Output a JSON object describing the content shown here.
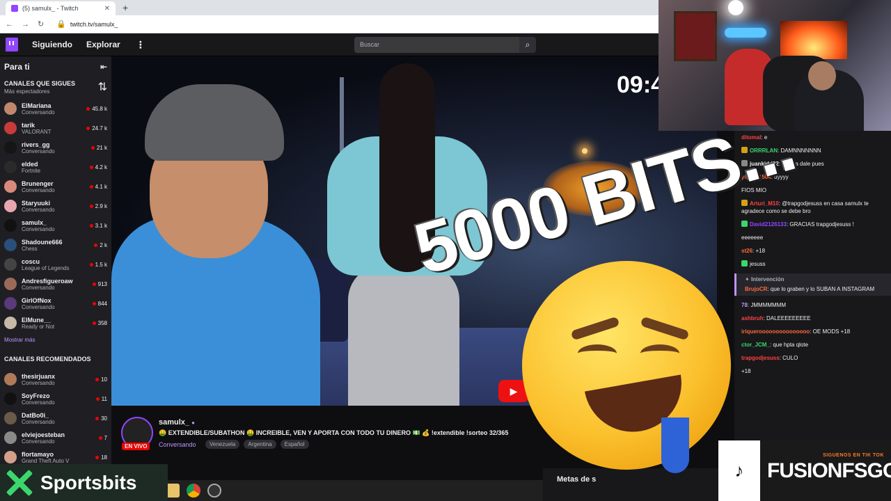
{
  "browser": {
    "tab_title": "(5) samulx_ - Twitch",
    "url": "twitch.tv/samulx_",
    "new_tab": "+",
    "close": "✕"
  },
  "nav": {
    "following": "Siguiendo",
    "explore": "Explorar",
    "more": "⋮",
    "search_placeholder": "Buscar"
  },
  "sidebar": {
    "header": "Para ti",
    "collapse": "⇤",
    "followed_title": "CANALES QUE SIGUES",
    "followed_sub": "Más espectadores",
    "sort": "⇅",
    "channels": [
      {
        "name": "ElMariana",
        "game": "Conversando",
        "viewers": "45.8 k",
        "color": "#c1876d"
      },
      {
        "name": "tarik",
        "game": "VALORANT",
        "viewers": "24.7 k",
        "color": "#c93a3a"
      },
      {
        "name": "rivers_gg",
        "game": "Conversando",
        "viewers": "21 k",
        "color": "#151515"
      },
      {
        "name": "elded",
        "game": "Fortnite",
        "viewers": "4.2 k",
        "color": "#2a2a2a"
      },
      {
        "name": "Brunenger",
        "game": "Conversando",
        "viewers": "4.1 k",
        "color": "#d88a7a"
      },
      {
        "name": "Staryuuki",
        "game": "Conversando",
        "viewers": "2.9 k",
        "color": "#e8a7b0"
      },
      {
        "name": "samulx_",
        "game": "Conversando",
        "viewers": "3.1 k",
        "color": "#111111"
      },
      {
        "name": "Shadoune666",
        "game": "Chess",
        "viewers": "2 k",
        "color": "#2a4f7a"
      },
      {
        "name": "coscu",
        "game": "League of Legends",
        "viewers": "1.5 k",
        "color": "#444444"
      },
      {
        "name": "Andresfigueroaw",
        "game": "Conversando",
        "viewers": "913",
        "color": "#9a6a58"
      },
      {
        "name": "GirlOfNox",
        "game": "Conversando",
        "viewers": "844",
        "color": "#5a3a7a"
      },
      {
        "name": "ElMune__",
        "game": "Ready or Not",
        "viewers": "358",
        "color": "#c7b8a8"
      }
    ],
    "show_more": "Mostrar más",
    "recommended_title": "CANALES RECOMENDADOS",
    "recommended": [
      {
        "name": "thesirjuanx",
        "game": "Conversando",
        "viewers": "10",
        "color": "#b07a5a"
      },
      {
        "name": "SoyFrezo",
        "game": "Conversando",
        "viewers": "11",
        "color": "#111111"
      },
      {
        "name": "DatBo0i_",
        "game": "Conversando",
        "viewers": "30",
        "color": "#6a5a4a"
      },
      {
        "name": "elviejoesteban",
        "game": "Conversando",
        "viewers": "7",
        "color": "#8a8a8a"
      },
      {
        "name": "flortamayo",
        "game": "Grand Theft Auto V",
        "viewers": "18",
        "color": "#d4a08a"
      }
    ]
  },
  "video": {
    "timer": "09:4",
    "yt_play": "▶"
  },
  "stream": {
    "name": "samulx_",
    "verified": "●",
    "live": "EN VIVO",
    "title": "🤑 EXTENDIBLE/SUBATHON 🤑 INCREIBLE, VEN Y APORTA CON TODO TU DINERO 💵 💰 !extendible !sorteo 32/365",
    "category": "Conversando",
    "tags": [
      "Venezuela",
      "Argentina",
      "Español"
    ]
  },
  "metas": "Metas de s",
  "chat": [
    {
      "user": "ditomal",
      "text": "e",
      "color": "#ff4040",
      "badge": ""
    },
    {
      "user": "ORRRLAN",
      "text": "DAMNNNNNNN",
      "color": "#3bd76d",
      "badge": "#d4a017"
    },
    {
      "user": "juankidd22",
      "text": "10k ya dale pues",
      "color": "#efeff1",
      "badge": "#888888"
    },
    {
      "user": "yisus_1504",
      "text": "uyyyy",
      "color": "#ff6a3a",
      "badge": ""
    },
    {
      "user": "",
      "text": "FIOS MIO",
      "color": "#3a6aff",
      "badge": ""
    },
    {
      "user": "Arturi_M10",
      "text": "@trapgodjesuss en casa samulx te agradece como se debe bro",
      "color": "#ff4040",
      "badge": "#d4a017"
    },
    {
      "user": "David2126133",
      "text": "GRACIAS trapgodjesuss !",
      "color": "#9146ff",
      "badge": "#3bd76d"
    },
    {
      "user": "",
      "text": "eeeeeee",
      "color": "#efeff1",
      "badge": ""
    },
    {
      "user": "st26",
      "text": "+18",
      "color": "#ff6a3a",
      "badge": ""
    },
    {
      "user": "",
      "text": "jesuss",
      "color": "#efeff1",
      "badge": "#3bd76d"
    }
  ],
  "pinned": {
    "header": "Intervención",
    "user": "BrujoCR",
    "text": "que lo graben y lo SUBAN A INSTAGRAM"
  },
  "chat2": [
    {
      "user": "78",
      "text": "JMMMMMMM",
      "color": "#bf94ff"
    },
    {
      "user": "ashbruh",
      "text": "DALEEEEEEEEE",
      "color": "#ff4040"
    },
    {
      "user": "iriquerooooooooooooooo",
      "text": "OE MODS +18",
      "color": "#ff6a3a"
    },
    {
      "user": "ctor_JCM_",
      "text": "que hpta qlote",
      "color": "#3bd76d"
    },
    {
      "user": "trapgodjesuss",
      "text": "CULO",
      "color": "#ff4040"
    },
    {
      "user": "",
      "text": "+18",
      "color": "#3a6aff"
    }
  ],
  "promo": {
    "tiktok_icon": "♪",
    "follow": "SIGUENOS EN TIK TOK",
    "brand": "FUSIONFSGG"
  },
  "sportsbits": "Sportsbits",
  "overlay": "5000 BITS..."
}
